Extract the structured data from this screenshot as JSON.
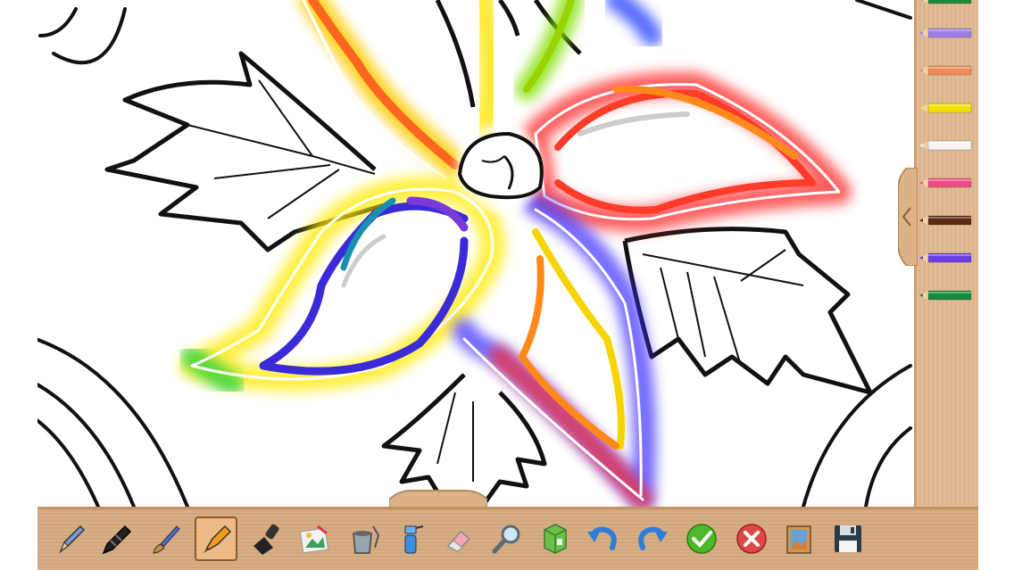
{
  "app": {
    "selected_tool": "marker"
  },
  "toolbar": {
    "tools": [
      {
        "name": "pencil",
        "icon": "pencil-icon"
      },
      {
        "name": "crayon",
        "icon": "crayon-icon"
      },
      {
        "name": "paint-brush",
        "icon": "paint-brush-icon"
      },
      {
        "name": "marker",
        "icon": "marker-icon",
        "selected": true
      },
      {
        "name": "stamp",
        "icon": "stamp-icon"
      },
      {
        "name": "image-sticker",
        "icon": "picture-icon"
      },
      {
        "name": "paint-bucket",
        "icon": "paint-bucket-icon"
      },
      {
        "name": "spray-bottle",
        "icon": "spray-bottle-icon"
      },
      {
        "name": "eraser",
        "icon": "eraser-icon"
      },
      {
        "name": "zoom",
        "icon": "magnifier-icon"
      },
      {
        "name": "texture-box",
        "icon": "box-icon"
      },
      {
        "name": "undo",
        "icon": "undo-icon"
      },
      {
        "name": "redo",
        "icon": "redo-icon"
      },
      {
        "name": "confirm",
        "icon": "checkmark-icon"
      },
      {
        "name": "cancel",
        "icon": "close-icon"
      },
      {
        "name": "gallery",
        "icon": "gallery-icon"
      },
      {
        "name": "save",
        "icon": "floppy-disk-icon"
      }
    ]
  },
  "palette": {
    "colors": [
      {
        "name": "green",
        "hex": "#1e8a3a"
      },
      {
        "name": "lavender",
        "hex": "#9b7fe6"
      },
      {
        "name": "salmon",
        "hex": "#f08a5d"
      },
      {
        "name": "yellow",
        "hex": "#f2e200"
      },
      {
        "name": "white",
        "hex": "#f5f5f5"
      },
      {
        "name": "pink",
        "hex": "#ee4d84"
      },
      {
        "name": "brown",
        "hex": "#5b2a12"
      },
      {
        "name": "violet",
        "hex": "#6a3fe0"
      },
      {
        "name": "dark-green",
        "hex": "#178a3b"
      }
    ]
  },
  "colors": {
    "panel_wood": "#e2bb92",
    "toolbar_wood": "#d7ab80",
    "line_art": "#111111"
  }
}
